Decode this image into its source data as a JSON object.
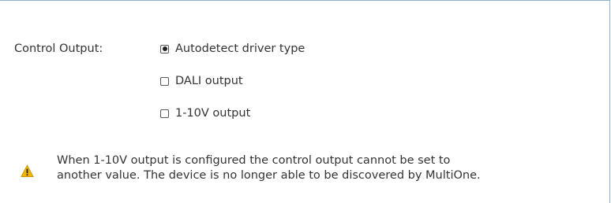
{
  "control_output": {
    "label": "Control Output:",
    "options": [
      {
        "label": "Autodetect driver type",
        "selected": true
      },
      {
        "label": "DALI output",
        "selected": false
      },
      {
        "label": "1-10V output",
        "selected": false
      }
    ]
  },
  "warning": {
    "icon": "warning-triangle-icon",
    "line1": "When 1-10V output is configured the control output cannot be set to",
    "line2": "another value. The device is no longer able to be discovered by MultiOne."
  },
  "colors": {
    "border": "#8fb3d6",
    "warning_fill": "#f2b705",
    "text": "#333333"
  }
}
